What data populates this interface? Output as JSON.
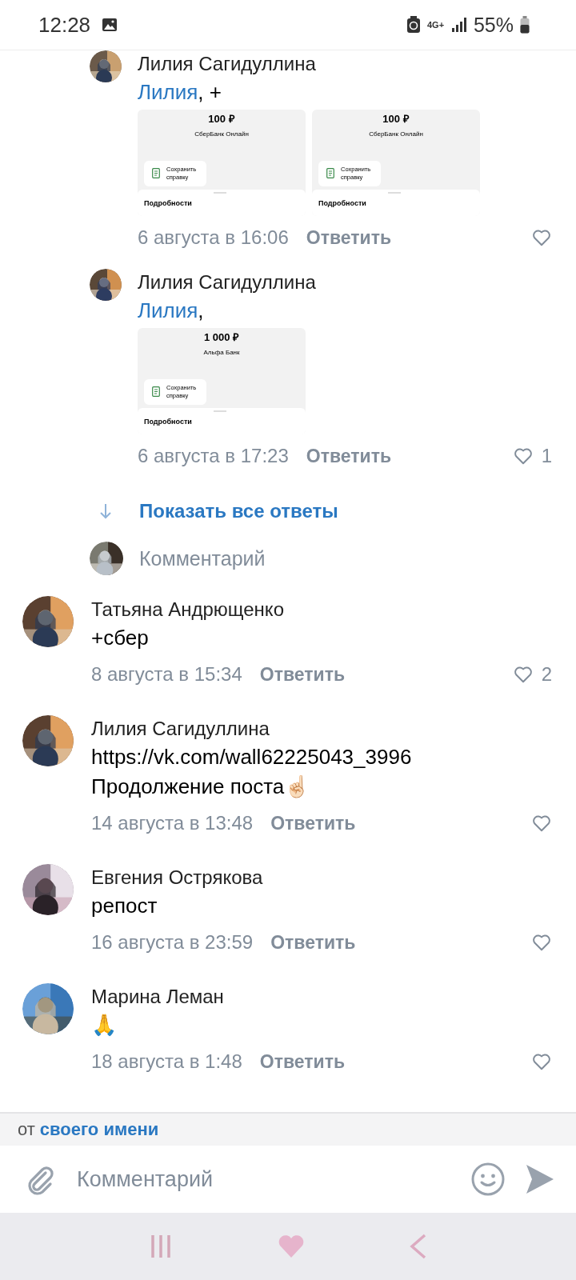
{
  "status_bar": {
    "time": "12:28",
    "network": "4G+",
    "battery": "55%"
  },
  "replies": [
    {
      "author": "Лилия Сагидуллина",
      "mention": "Лилия",
      "text": ", +",
      "attachments": [
        {
          "amount": "100 ₽",
          "bank": "СберБанк Онлайн",
          "save": "Сохранить справку",
          "details": "Подробности"
        },
        {
          "amount": "100 ₽",
          "bank": "СберБанк Онлайн",
          "save": "Сохранить справку",
          "details": "Подробности"
        }
      ],
      "date": "6 августа в 16:06",
      "reply": "Ответить"
    },
    {
      "author": "Лилия Сагидуллина",
      "mention": "Лилия",
      "text": ",",
      "attachments": [
        {
          "amount": "1 000 ₽",
          "bank": "Альфа Банк",
          "save": "Сохранить справку",
          "details": "Подробности"
        }
      ],
      "date": "6 августа в 17:23",
      "reply": "Ответить",
      "likes": "1"
    }
  ],
  "show_all": "Показать все ответы",
  "reply_input": {
    "placeholder": "Комментарий"
  },
  "comments": [
    {
      "author": "Татьяна Андрющенко",
      "text": "+сбер",
      "date": "8 августа в 15:34",
      "reply": "Ответить",
      "likes": "2"
    },
    {
      "author": "Лилия Сагидуллина",
      "link": "https://vk.com/wall62225043_3996",
      "text": "Продолжение поста☝🏻",
      "date": "14 августа в 13:48",
      "reply": "Ответить"
    },
    {
      "author": "Евгения Острякова",
      "text": "репост",
      "date": "16 августа в 23:59",
      "reply": "Ответить"
    },
    {
      "author": "Марина Леман",
      "text": "🙏",
      "date": "18 августа в 1:48",
      "reply": "Ответить"
    }
  ],
  "sender": {
    "prefix": "от",
    "name": "своего имени"
  },
  "composer": {
    "placeholder": "Комментарий"
  }
}
